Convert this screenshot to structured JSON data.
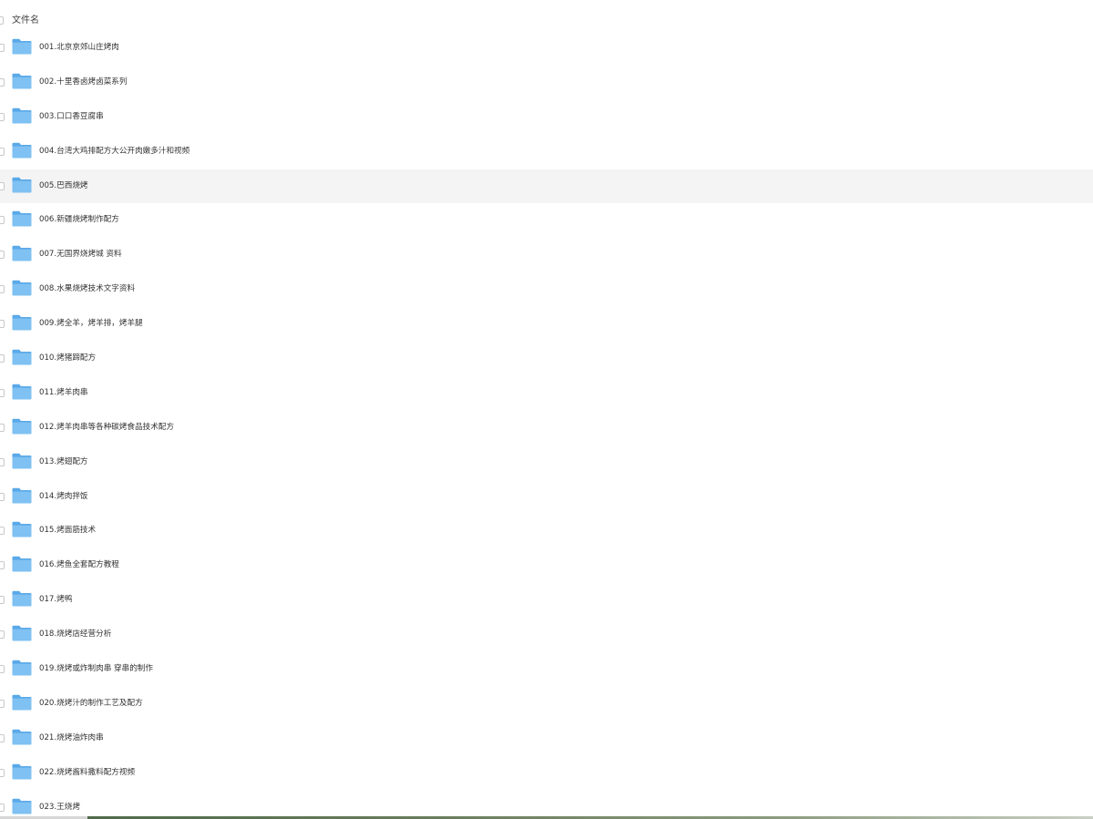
{
  "header": {
    "column_label": "文件名"
  },
  "hover_row_index": 4,
  "rows": [
    {
      "name": "001.北京京郊山庄烤肉"
    },
    {
      "name": "002.十里香卤烤卤菜系列"
    },
    {
      "name": "003.口口香豆腐串"
    },
    {
      "name": "004.台湾大鸡排配方大公开肉嫩多汁和视频"
    },
    {
      "name": "005.巴西烧烤"
    },
    {
      "name": "006.新疆烧烤制作配方"
    },
    {
      "name": "007.无国界烧烤城 资料"
    },
    {
      "name": "008.水果烧烤技术文字资料"
    },
    {
      "name": "009.烤全羊，烤羊排，烤羊腿"
    },
    {
      "name": "010.烤猪蹄配方"
    },
    {
      "name": "011.烤羊肉串"
    },
    {
      "name": "012.烤羊肉串等各种碳烤食品技术配方"
    },
    {
      "name": "013.烤翅配方"
    },
    {
      "name": "014.烤肉拌饭"
    },
    {
      "name": "015.烤面筋技术"
    },
    {
      "name": "016.烤鱼全套配方教程"
    },
    {
      "name": "017.烤鸭"
    },
    {
      "name": "018.烧烤店经营分析"
    },
    {
      "name": "019.烧烤或炸制肉串 穿串的制作"
    },
    {
      "name": "020.烧烤汁的制作工艺及配方"
    },
    {
      "name": "021.烧烤油炸肉串"
    },
    {
      "name": "022.烧烤酱料撒料配方视频"
    },
    {
      "name": "023.王烧烤"
    }
  ],
  "icons": {
    "row_icon": "folder-icon",
    "select_control": "checkbox"
  },
  "colors": {
    "folder_front": "#7fc1f2",
    "folder_back": "#5aa9e8",
    "hover_bg": "#f4f4f5",
    "text": "#333333"
  }
}
